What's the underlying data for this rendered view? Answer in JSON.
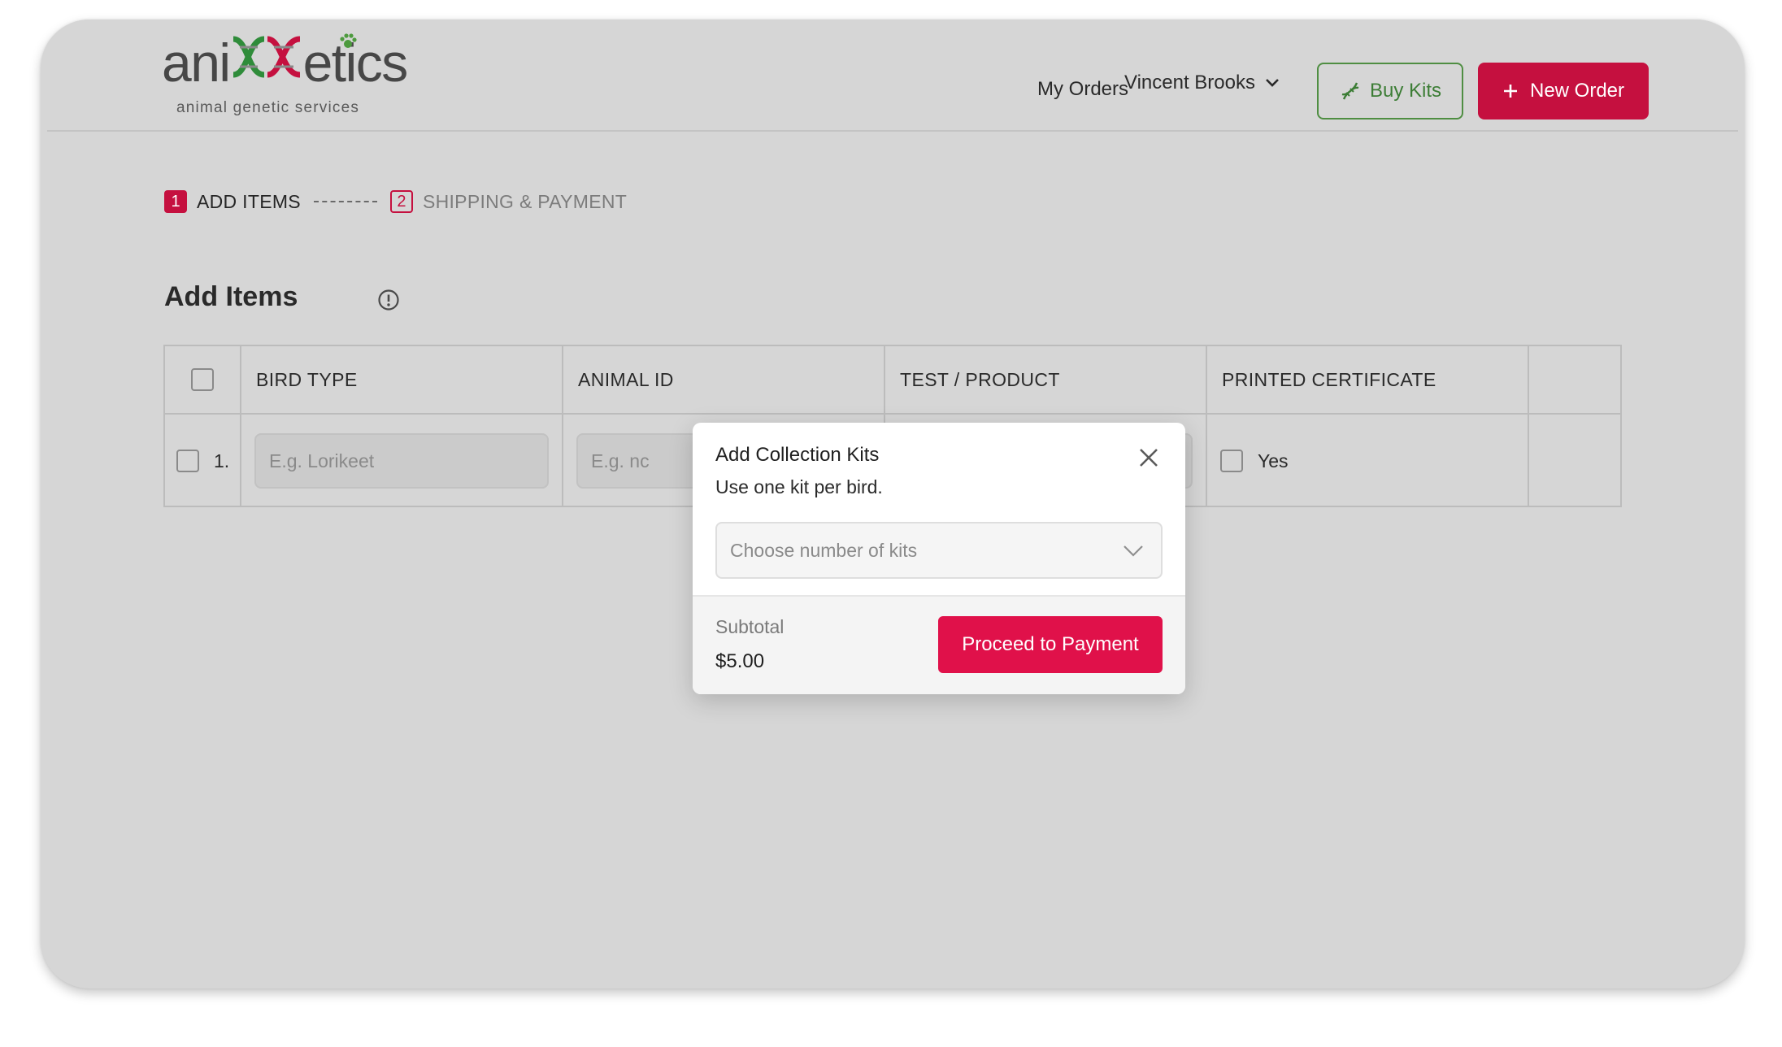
{
  "logo": {
    "word_pre": "ani",
    "word_post": "etics",
    "tagline": "animal genetic services"
  },
  "header": {
    "my_orders": "My Orders",
    "user_name": "Vincent Brooks",
    "buy_kits": "Buy Kits",
    "new_order": "New Order"
  },
  "stepper": {
    "steps": [
      {
        "number": "1",
        "label": "ADD ITEMS"
      },
      {
        "number": "2",
        "label": "SHIPPING & PAYMENT"
      }
    ]
  },
  "page": {
    "title": "Add Items"
  },
  "table": {
    "columns": [
      "BIRD TYPE",
      "ANIMAL ID",
      "TEST / PRODUCT",
      "PRINTED CERTIFICATE"
    ],
    "rows": [
      {
        "number": "1.",
        "bird_type_placeholder": "E.g. Lorikeet",
        "animal_id_placeholder": "E.g. nc",
        "certificate_label": "Yes"
      }
    ]
  },
  "modal": {
    "title": "Add Collection Kits",
    "subtitle": "Use one kit per bird.",
    "select_placeholder": "Choose number of kits",
    "subtotal_label": "Subtotal",
    "subtotal_value": "$5.00",
    "proceed_button": "Proceed to Payment"
  },
  "colors": {
    "brand_red": "#c5103f",
    "proceed_red": "#e0114a",
    "kit_green": "#3c7d35",
    "overlay_gray": "#d6d6d6"
  },
  "icons": [
    "chevron-down-icon",
    "dna-icon",
    "plus-icon",
    "info-icon",
    "close-icon",
    "paw-icon"
  ]
}
